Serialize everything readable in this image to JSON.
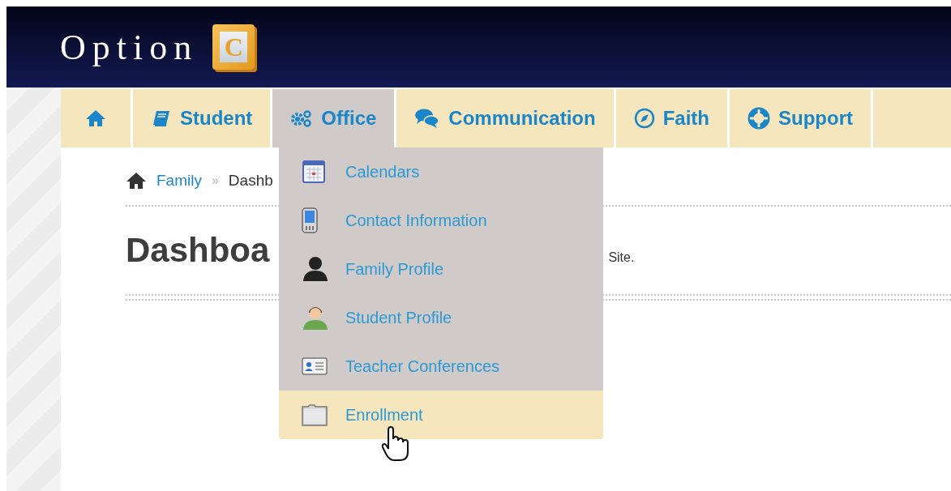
{
  "header": {
    "logo_text": "Option",
    "logo_block_letter": "C"
  },
  "nav": {
    "tabs": [
      {
        "kind": "home",
        "selected": false
      },
      {
        "kind": "label",
        "label": "Student",
        "selected": false
      },
      {
        "kind": "label",
        "label": "Office",
        "selected": true
      },
      {
        "kind": "label",
        "label": "Communication",
        "selected": false
      },
      {
        "kind": "label",
        "label": "Faith",
        "selected": false
      },
      {
        "kind": "label",
        "label": "Support",
        "selected": false
      }
    ]
  },
  "office_menu": {
    "items": [
      {
        "label": "Calendars",
        "selected": false
      },
      {
        "label": "Contact Information",
        "selected": false
      },
      {
        "label": "Family Profile",
        "selected": false
      },
      {
        "label": "Student Profile",
        "selected": false
      },
      {
        "label": "Teacher Conferences",
        "selected": false
      },
      {
        "label": "Enrollment",
        "selected": true
      }
    ]
  },
  "breadcrumb": {
    "items": [
      "Family",
      "Dashb"
    ],
    "separator": "»"
  },
  "page": {
    "title": "Dashboa",
    "welcome": "Site."
  }
}
